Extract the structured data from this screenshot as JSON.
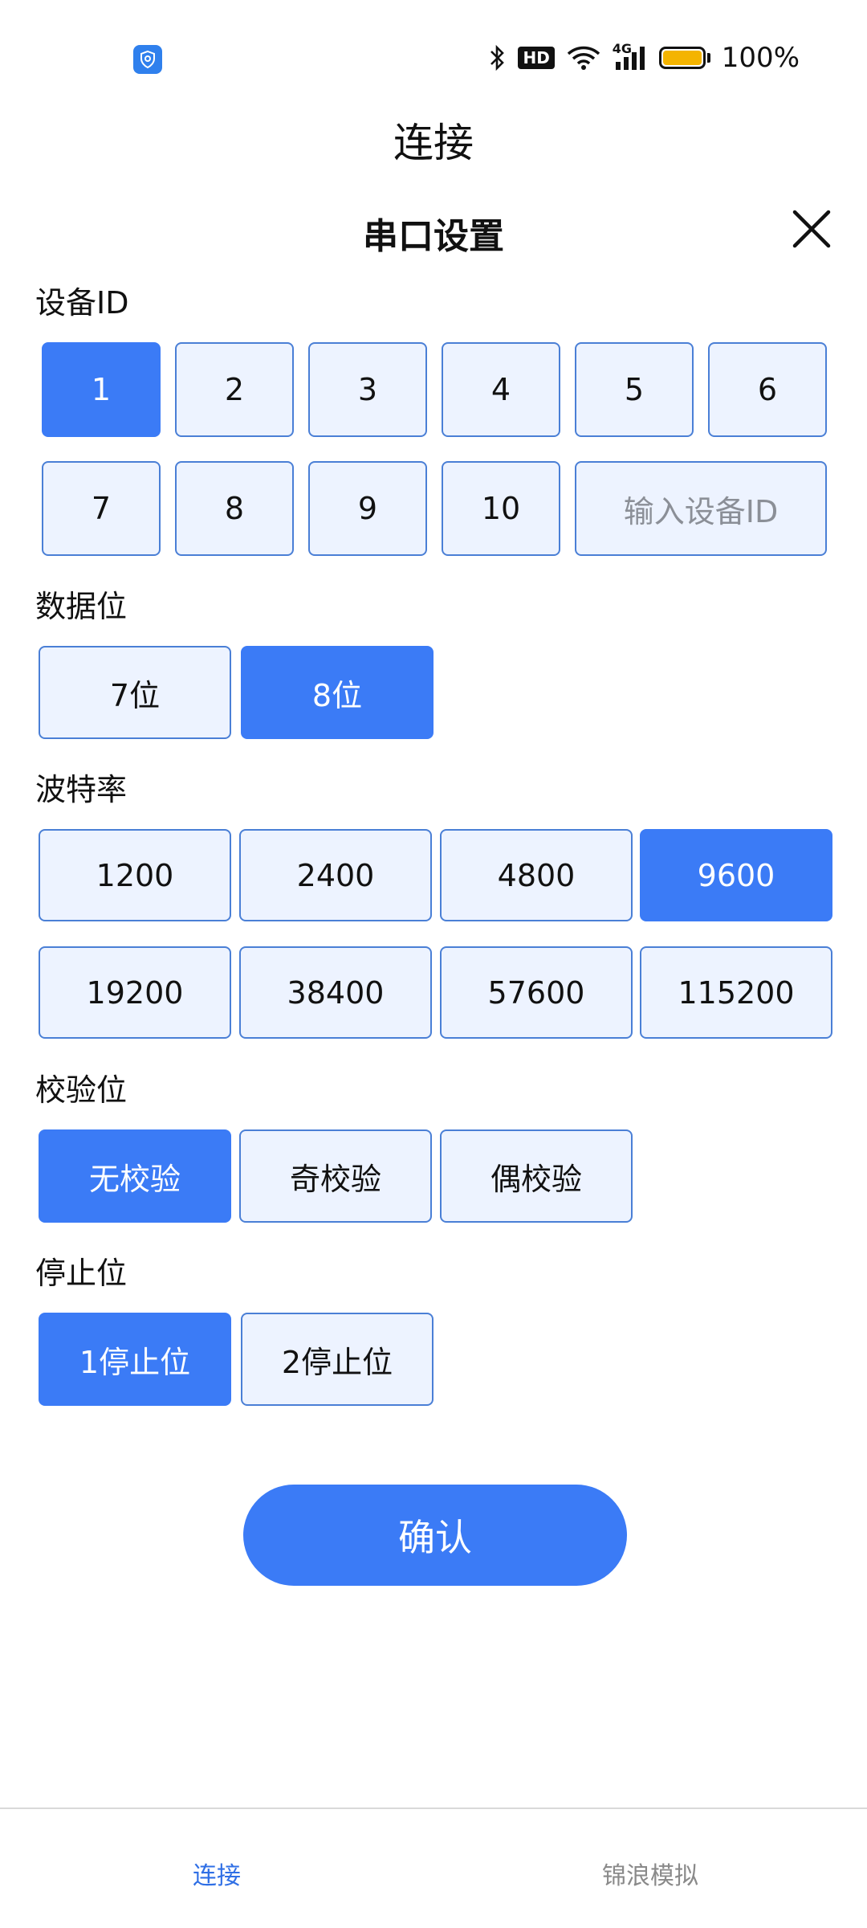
{
  "status_bar": {
    "left_icon": "shield-icon",
    "bluetooth_icon": "bluetooth-icon",
    "hd_label": "HD",
    "wifi_icon": "wifi-icon",
    "network_label": "4G",
    "signal_icon": "signal-icon",
    "battery_percent": "100%",
    "battery_level": 1.0,
    "battery_color": "#f4b400"
  },
  "app_title": "连接",
  "dialog": {
    "title": "串口设置",
    "close_icon": "close-icon",
    "sections": {
      "device_id": {
        "label": "设备ID",
        "options": [
          "1",
          "2",
          "3",
          "4",
          "5",
          "6",
          "7",
          "8",
          "9",
          "10"
        ],
        "selected": "1",
        "input_placeholder": "输入设备ID"
      },
      "data_bits": {
        "label": "数据位",
        "options": [
          "7位",
          "8位"
        ],
        "selected": "8位"
      },
      "baud_rate": {
        "label": "波特率",
        "options": [
          "1200",
          "2400",
          "4800",
          "9600",
          "19200",
          "38400",
          "57600",
          "115200"
        ],
        "selected": "9600"
      },
      "parity": {
        "label": "校验位",
        "options": [
          "无校验",
          "奇校验",
          "偶校验"
        ],
        "selected": "无校验"
      },
      "stop_bits": {
        "label": "停止位",
        "options": [
          "1停止位",
          "2停止位"
        ],
        "selected": "1停止位"
      }
    },
    "confirm_label": "确认"
  },
  "bottom_nav": {
    "tabs": [
      {
        "label": "连接",
        "active": true
      },
      {
        "label": "锦浪模拟",
        "active": false
      }
    ]
  },
  "colors": {
    "accent": "#3b7bf6",
    "option_bg": "#edf3ff",
    "option_border": "#4a7fd6",
    "active_tab": "#2f6fe5",
    "inactive_tab": "#8a8a8a"
  }
}
